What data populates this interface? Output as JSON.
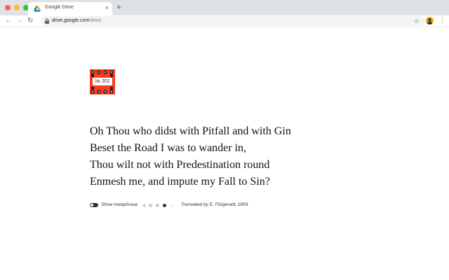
{
  "browser": {
    "tab_title": "Google Drive",
    "tab_close": "×",
    "new_tab": "+",
    "back": "←",
    "forward": "→",
    "reload": "↻",
    "url_host": "drive.google.com",
    "url_path": "/drive",
    "star": "☆",
    "menu": "⋮",
    "icons": [
      "google-drive-icon",
      "lock-icon",
      "star-icon",
      "profile-avatar",
      "kebab-menu-icon"
    ]
  },
  "badge": {
    "label": "№ 301",
    "color": "#ff3b1f"
  },
  "poem": {
    "lines": [
      "Oh Thou who didst with Pitfall and with Gin",
      "Beset the Road I was to wander in,",
      "Thou wilt not with Predestination round",
      "Enmesh me, and impute my Fall to Sin?"
    ]
  },
  "controls": {
    "toggle_label": "Show metaphrase",
    "toggle_on": false,
    "prev": "‹",
    "next": "›",
    "page_count": 3,
    "active_page": 3,
    "credit": "Translated by E. Fitzgerald, 1859."
  }
}
